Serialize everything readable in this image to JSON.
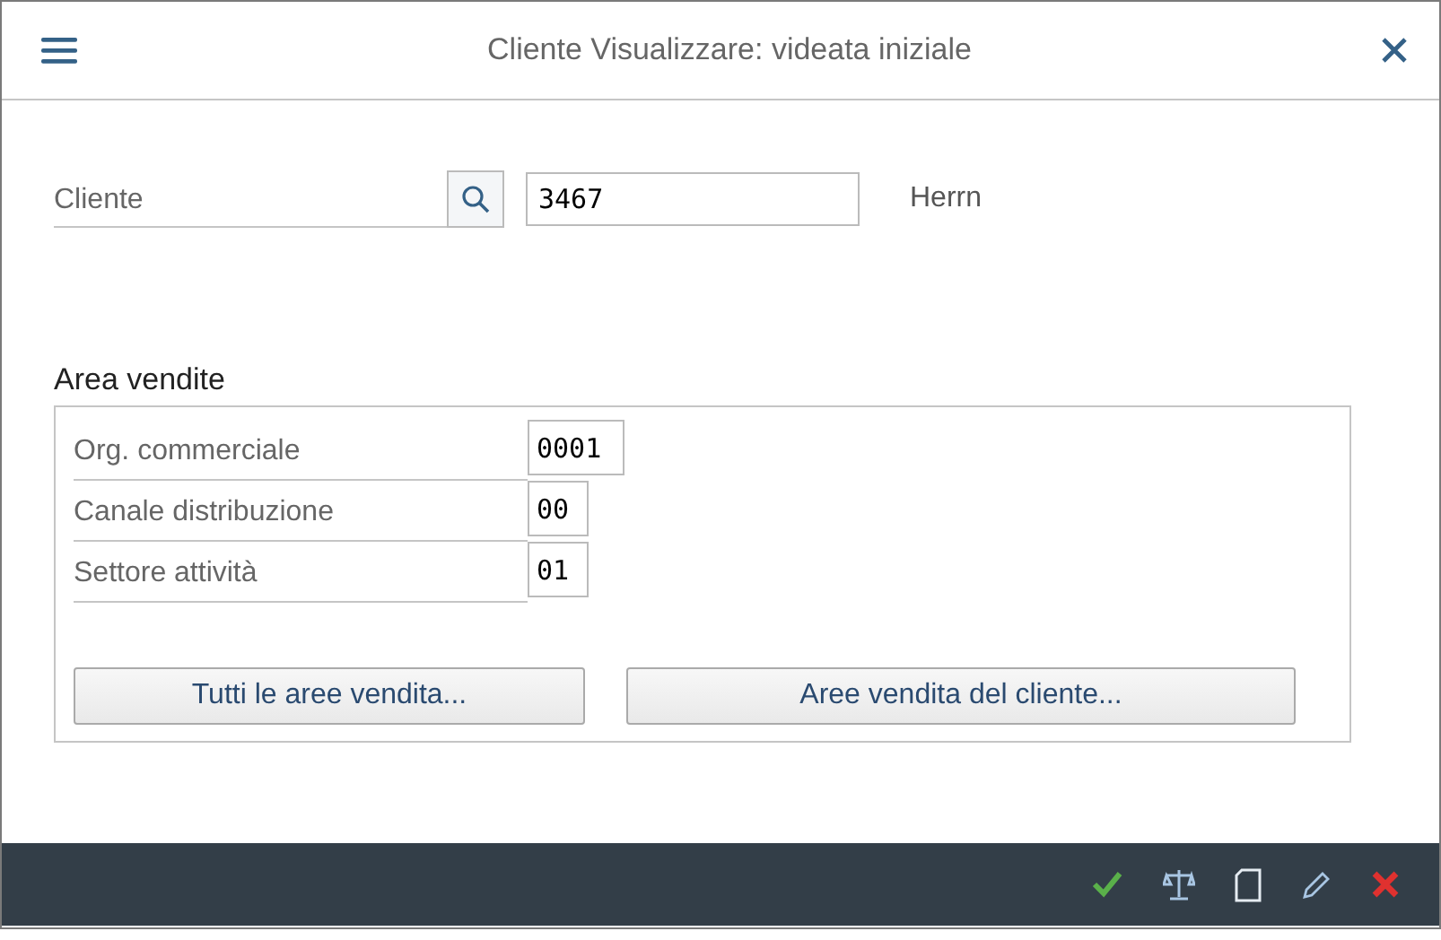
{
  "window": {
    "title": "Cliente Visualizzare: videata iniziale"
  },
  "customer": {
    "label": "Cliente",
    "value": "3467",
    "description": "Herrn"
  },
  "sales_area": {
    "title": "Area vendite",
    "fields": [
      {
        "label": "Org. commerciale",
        "value": "0001"
      },
      {
        "label": "Canale distribuzione",
        "value": "00"
      },
      {
        "label": "Settore attività",
        "value": "01"
      }
    ],
    "buttons": [
      "Tutti le aree vendita...",
      "Aree vendita del cliente..."
    ]
  },
  "footer": {
    "actions": [
      {
        "kind": "confirm"
      },
      {
        "kind": "compare"
      },
      {
        "kind": "new"
      },
      {
        "kind": "edit"
      },
      {
        "kind": "cancel"
      }
    ]
  }
}
